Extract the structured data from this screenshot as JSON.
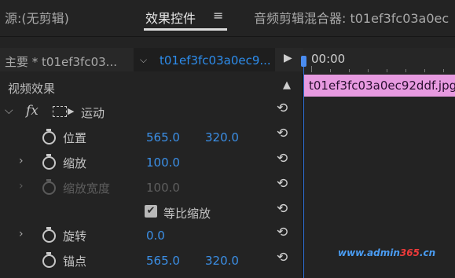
{
  "tabs": {
    "source": "源:(无剪辑)",
    "effect_controls": "效果控件",
    "menu_icon": "≡",
    "audio_mixer": "音频剪辑混合器: t01ef3fc03a0ec"
  },
  "source_row": {
    "master": "主要 * t01ef3fc03...",
    "clip": "t01ef3fc03a0ec9..."
  },
  "timeline": {
    "timecode": "00:00",
    "clip_name": "t01ef3fc03a0ec92ddf.jpg"
  },
  "panel": {
    "video_effects": "视频效果",
    "fx": "fx",
    "motion": "运动",
    "properties": [
      {
        "label": "位置",
        "value1": "565.0",
        "value2": "320.0"
      },
      {
        "label": "缩放",
        "value1": "100.0"
      },
      {
        "label": "缩放宽度",
        "value1": "100.0"
      },
      {
        "label": "等比缩放"
      },
      {
        "label": "旋转",
        "value1": "0.0"
      },
      {
        "label": "锚点",
        "value1": "565.0",
        "value2": "320.0"
      }
    ]
  },
  "watermark": {
    "prefix": "www.admin",
    "num": "365",
    "suffix": ".cn"
  },
  "colors": {
    "accent": "#3b8fe6",
    "clip": "#e79ae0",
    "background": "#232323"
  }
}
